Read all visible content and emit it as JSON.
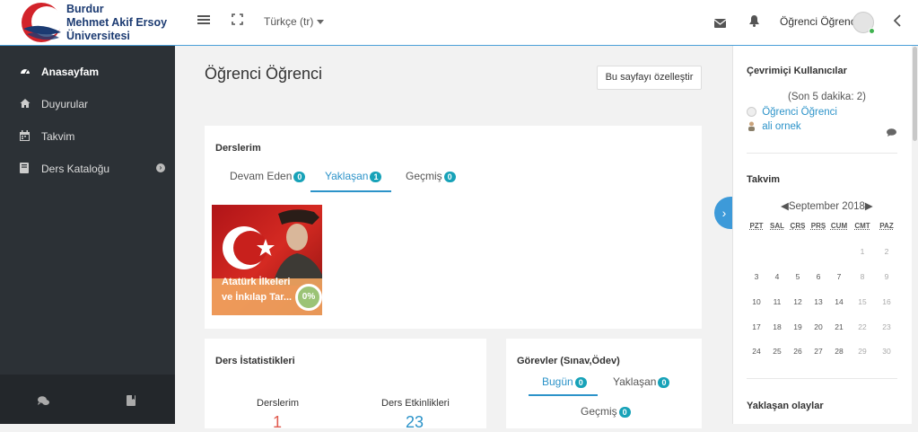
{
  "header": {
    "logo_lines": [
      "Burdur",
      "Mehmet Akif Ersoy",
      "Üniversitesi"
    ],
    "language": "Türkçe (tr)",
    "user_name": "Öğrenci Öğrenci"
  },
  "sidebar": {
    "items": [
      {
        "label": "Anasayfam",
        "icon": "dashboard-icon",
        "active": true
      },
      {
        "label": "Duyurular",
        "icon": "home-icon",
        "active": false
      },
      {
        "label": "Takvim",
        "icon": "calendar-icon",
        "active": false
      },
      {
        "label": "Ders Kataloğu",
        "icon": "book-icon",
        "active": false
      }
    ]
  },
  "main": {
    "page_title": "Öğrenci Öğrenci",
    "customize_button": "Bu sayfayı özelleştir",
    "courses": {
      "title": "Derslerim",
      "tabs": [
        {
          "label": "Devam Eden",
          "count": "0"
        },
        {
          "label": "Yaklaşan",
          "count": "1"
        },
        {
          "label": "Geçmiş",
          "count": "0"
        }
      ],
      "active_tab": "Yaklaşan",
      "course": {
        "name": "Atatürk İlkeleri ve İnkılap Tar...",
        "progress": "0%"
      }
    },
    "stats": {
      "title": "Ders İstatistikleri",
      "col1_label": "Derslerim",
      "col1_value": "1",
      "col2_label": "Ders Etkinlikleri",
      "col2_value": "23"
    },
    "tasks": {
      "title": "Görevler (Sınav,Ödev)",
      "tabs": [
        {
          "label": "Bugün",
          "count": "0"
        },
        {
          "label": "Yaklaşan",
          "count": "0"
        },
        {
          "label": "Geçmiş",
          "count": "0"
        }
      ]
    }
  },
  "right": {
    "online_title": "Çevrimiçi Kullanıcılar",
    "online_subtitle": "(Son 5 dakika: 2)",
    "online_users": [
      "Öğrenci Öğrenci",
      "ali ornek"
    ],
    "calendar_title": "Takvim",
    "calendar_month": "September 2018",
    "calendar_weekdays": [
      "PZT",
      "SAL",
      "ÇRŞ",
      "PRŞ",
      "CUM",
      "CMT",
      "PAZ"
    ],
    "calendar_weeks": [
      [
        "",
        "",
        "",
        "",
        "",
        "1",
        "2"
      ],
      [
        "3",
        "4",
        "5",
        "6",
        "7",
        "8",
        "9"
      ],
      [
        "10",
        "11",
        "12",
        "13",
        "14",
        "15",
        "16"
      ],
      [
        "17",
        "18",
        "19",
        "20",
        "21",
        "22",
        "23"
      ],
      [
        "24",
        "25",
        "26",
        "27",
        "28",
        "29",
        "30"
      ]
    ],
    "upcoming_title": "Yaklaşan olaylar"
  },
  "colors": {
    "accent": "#2c93c9",
    "sidebar_bg": "#2c3136",
    "badge": "#17a2b8"
  }
}
